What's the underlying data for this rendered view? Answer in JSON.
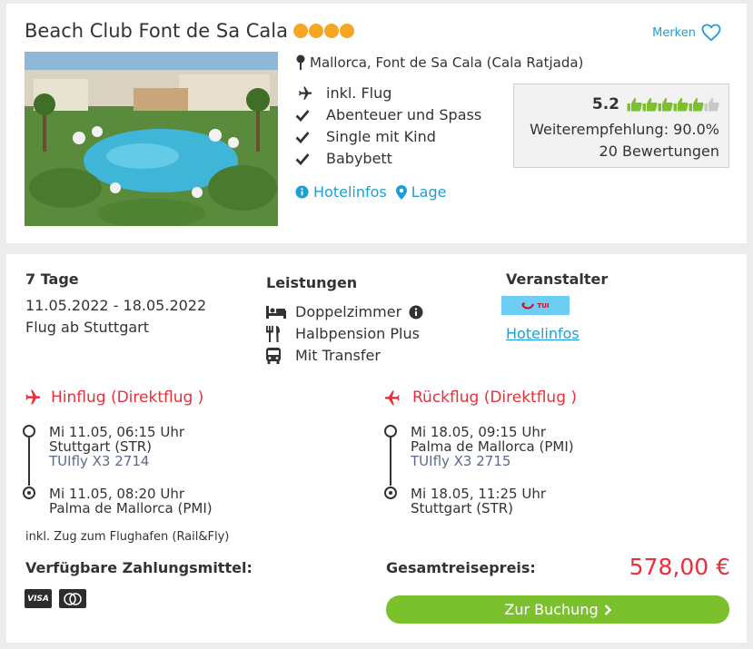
{
  "hotel": {
    "name": "Beach Club Font de Sa Cala",
    "merken_label": "Merken",
    "location": "Mallorca, Font de Sa Cala (Cala Ratjada)",
    "features": [
      "inkl. Flug",
      "Abenteuer und Spass",
      "Single mit Kind",
      "Babybett"
    ],
    "links": {
      "hotelinfos": "Hotelinfos",
      "lage": "Lage"
    },
    "rating": {
      "score": "5.2",
      "recommendation": "Weiterempfehlung: 90.0%",
      "reviews": "20 Bewertungen"
    }
  },
  "trip": {
    "duration": "7 Tage",
    "dates": "11.05.2022 - 18.05.2022",
    "departure": "Flug ab Stuttgart",
    "leistungen_heading": "Leistungen",
    "services": [
      "Doppelzimmer",
      "Halbpension Plus",
      "Mit Transfer"
    ],
    "veranstalter_heading": "Veranstalter",
    "veranstalter_logo_text": "TUI",
    "veranstalter_link": "Hotelinfos"
  },
  "outbound": {
    "title": "Hinflug (Direktflug )",
    "dep_time": "Mi 11.05, 06:15 Uhr",
    "dep_airport": "Stuttgart (STR)",
    "flight": "TUIfly X3 2714",
    "arr_time": "Mi 11.05, 08:20 Uhr",
    "arr_airport": "Palma de Mallorca (PMI)"
  },
  "return": {
    "title": "Rückflug (Direktflug )",
    "dep_time": "Mi 18.05, 09:15 Uhr",
    "dep_airport": "Palma de Mallorca (PMI)",
    "flight": "TUIfly X3 2715",
    "arr_time": "Mi 18.05, 11:25 Uhr",
    "arr_airport": "Stuttgart (STR)"
  },
  "rail_fly": "inkl. Zug zum Flughafen (Rail&Fly)",
  "payment": {
    "heading": "Verfügbare Zahlungsmittel:",
    "methods": [
      "VISA",
      "Mastercard"
    ]
  },
  "total": {
    "label": "Gesamtreisepreis:",
    "price": "578,00 €"
  },
  "cta": {
    "label": "Zur Buchung"
  },
  "colors": {
    "accent": "#1aa0d8",
    "price": "#e8303a",
    "cta": "#7ac12d",
    "stars": "#f5a623",
    "thumbs": "#7ac12d"
  },
  "icons": [
    "heart-icon",
    "map-pin-icon",
    "plane-icon",
    "check-icon",
    "thumbs-up-icon",
    "info-icon",
    "location-icon",
    "bed-icon",
    "cutlery-icon",
    "bus-icon",
    "chevron-right-icon",
    "visa-icon",
    "mastercard-icon"
  ]
}
